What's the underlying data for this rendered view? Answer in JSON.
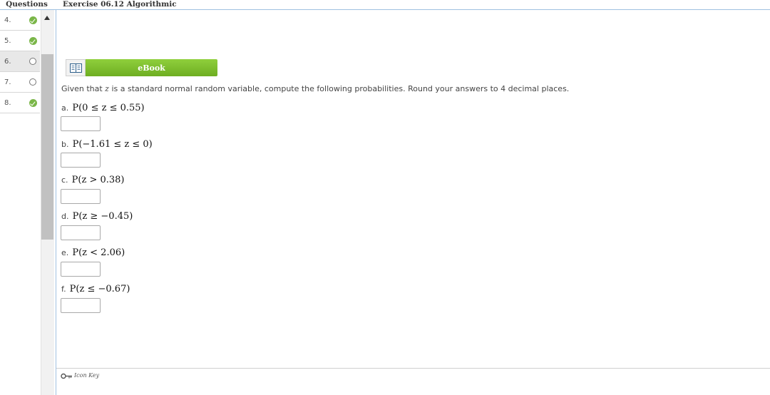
{
  "sidebar": {
    "header": "Questions",
    "questions": [
      {
        "number": "4.",
        "status": "complete"
      },
      {
        "number": "5.",
        "status": "complete"
      },
      {
        "number": "6.",
        "status": "incomplete",
        "active": true
      },
      {
        "number": "7.",
        "status": "incomplete"
      },
      {
        "number": "8.",
        "status": "complete"
      }
    ]
  },
  "exercise": {
    "title": "Exercise 06.12 Algorithmic",
    "ebook_label": "eBook",
    "instructions_before": "Given that ",
    "instructions_var": "z",
    "instructions_after": " is a standard normal random variable, compute the following probabilities. Round your answers to 4 decimal places.",
    "parts": [
      {
        "label": "a.",
        "expression": "P(0 ≤ z ≤ 0.55)",
        "value": ""
      },
      {
        "label": "b.",
        "expression": "P(−1.61 ≤ z ≤ 0)",
        "value": ""
      },
      {
        "label": "c.",
        "expression": "P(z > 0.38)",
        "value": ""
      },
      {
        "label": "d.",
        "expression": "P(z ≥ −0.45)",
        "value": ""
      },
      {
        "label": "e.",
        "expression": "P(z < 2.06)",
        "value": ""
      },
      {
        "label": "f.",
        "expression": "P(z ≤ −0.67)",
        "value": ""
      }
    ]
  },
  "footer": {
    "icon_key_label": "Icon Key"
  },
  "colors": {
    "accent_green": "#7ab648",
    "ebook_green": "#7dbf2e",
    "rule_blue": "#9fc0e0"
  }
}
